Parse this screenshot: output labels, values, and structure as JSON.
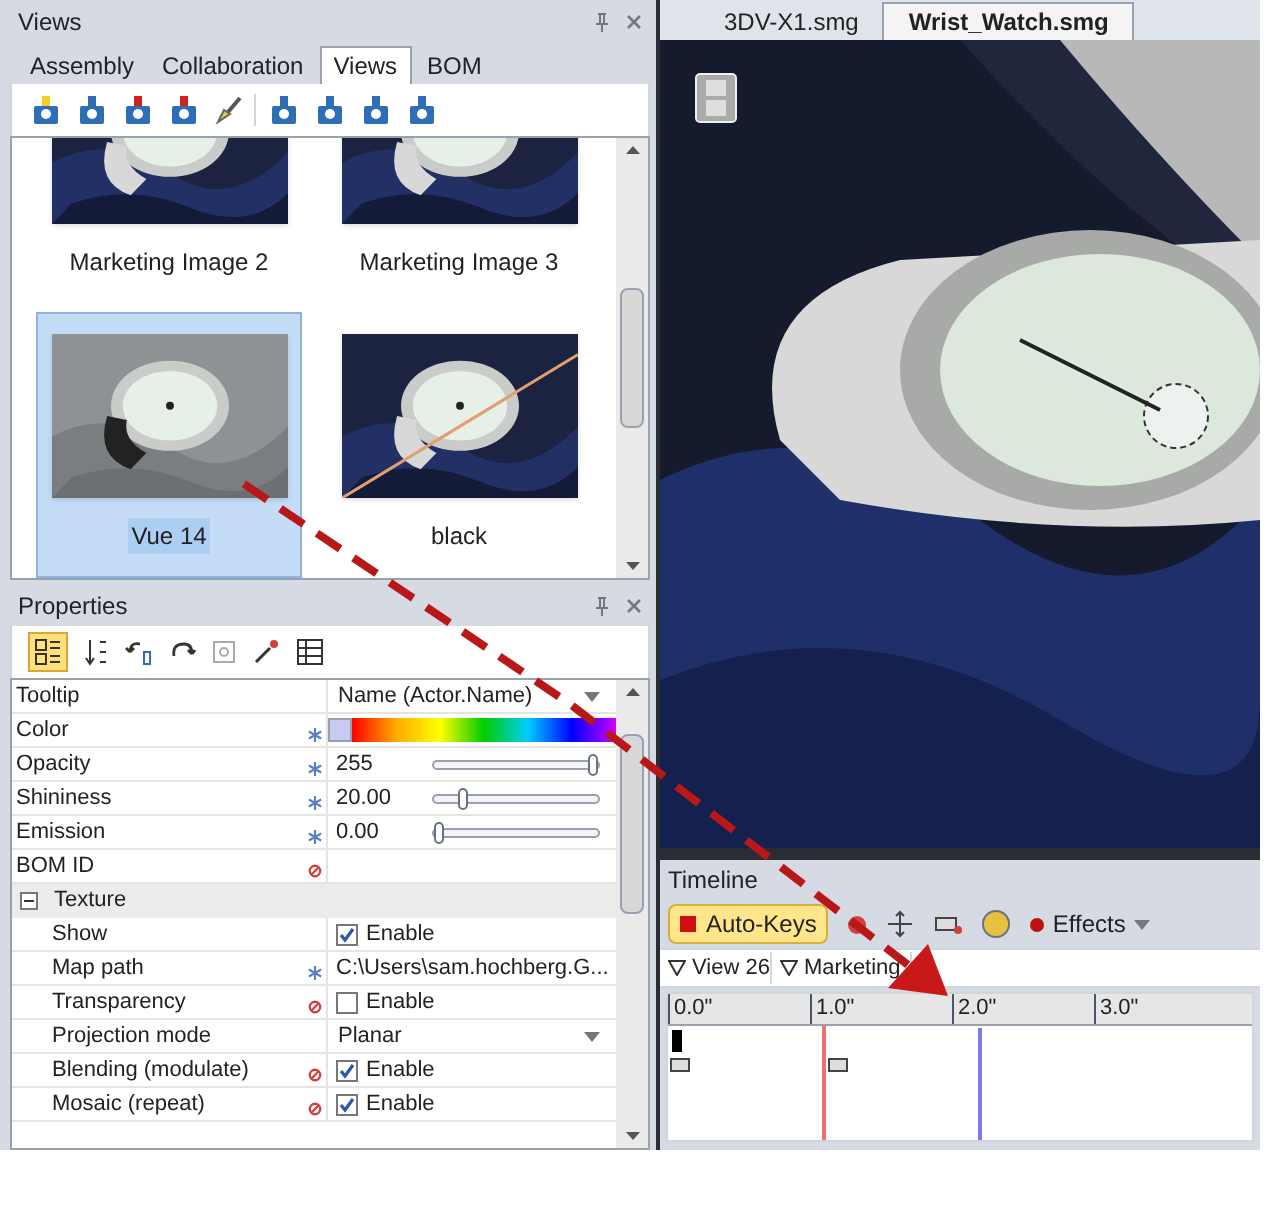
{
  "views_panel": {
    "title": "Views",
    "tabs": [
      {
        "label": "Assembly",
        "selected": false
      },
      {
        "label": "Collaboration",
        "selected": false
      },
      {
        "label": "Views",
        "selected": true
      },
      {
        "label": "BOM",
        "selected": false
      }
    ],
    "items": [
      {
        "label": "Marketing Image 2",
        "selected": false,
        "kind": "picture"
      },
      {
        "label": "Marketing Image 3",
        "selected": false,
        "kind": "picture"
      },
      {
        "label": "Vue 14",
        "selected": true,
        "kind": "picture"
      },
      {
        "label": "black",
        "selected": false,
        "kind": "picture"
      }
    ]
  },
  "properties_panel": {
    "title": "Properties",
    "rows": [
      {
        "kind": "dropdown",
        "name": "Tooltip",
        "value": "Name (Actor.Name)"
      },
      {
        "kind": "color",
        "name": "Color",
        "color": "#c8caf2",
        "marker": {
          "kind": "asterisk"
        }
      },
      {
        "kind": "slider",
        "name": "Opacity",
        "value": "255",
        "level": 1,
        "marker": {
          "kind": "asterisk"
        }
      },
      {
        "kind": "slider",
        "name": "Shininess",
        "value": "20.00",
        "level": 0.15,
        "marker": {
          "kind": "asterisk"
        }
      },
      {
        "kind": "slider",
        "name": "Emission",
        "value": "0.00",
        "level": 0,
        "marker": {
          "kind": "asterisk"
        }
      },
      {
        "kind": "text",
        "name": "BOM ID",
        "marker": {
          "kind": "circle"
        }
      },
      {
        "kind": "group",
        "name": "Texture",
        "expanded": true,
        "children": [
          {
            "kind": "checkbox",
            "name": "Show",
            "value": "Enable",
            "checked": true
          },
          {
            "kind": "text",
            "name": "Map path",
            "value": "C:\\Users\\sam.hochberg.G...",
            "marker": {
              "kind": "asterisk"
            }
          },
          {
            "kind": "checkbox",
            "name": "Transparency",
            "value": "Enable",
            "checked": false,
            "marker": {
              "kind": "circle"
            }
          },
          {
            "kind": "dropdown",
            "name": "Projection mode",
            "value": "Planar"
          },
          {
            "kind": "checkbox",
            "name": "Blending (modulate)",
            "value": "Enable",
            "checked": true,
            "marker": {
              "kind": "circle"
            }
          },
          {
            "kind": "checkbox",
            "name": "Mosaic (repeat)",
            "value": "Enable",
            "checked": true,
            "marker": {
              "kind": "circle"
            }
          }
        ]
      }
    ]
  },
  "document_tabs": [
    {
      "label": "3DV-X1.smg",
      "selected": false
    },
    {
      "label": "Wrist_Watch.smg",
      "selected": true
    }
  ],
  "timeline": {
    "title": "Timeline",
    "auto_keys": "Auto-Keys",
    "effects": "Effects",
    "tracks": [
      "View 26",
      "Marketing"
    ],
    "ruler": [
      "0.0\"",
      "1.0\"",
      "2.0\"",
      "3.0\""
    ]
  }
}
